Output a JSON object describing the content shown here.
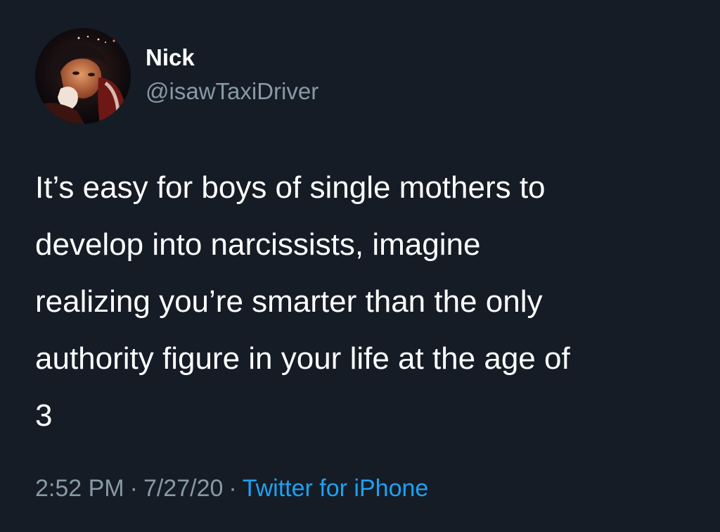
{
  "tweet": {
    "author": {
      "name": "Nick",
      "handle": "@isawTaxiDriver"
    },
    "text_lines": [
      "It’s easy for boys of single mothers to",
      "develop into narcissists, imagine",
      "realizing you’re smarter than the only",
      "authority figure in your life at the age of",
      "3"
    ],
    "time": "2:52 PM",
    "date": "7/27/20",
    "separator": "·",
    "source": "Twitter for iPhone"
  },
  "colors": {
    "background": "#151c26",
    "text": "#ffffff",
    "secondary": "#8899a6",
    "link": "#1da1f2"
  },
  "icons": {
    "avatar": "profile-photo"
  }
}
